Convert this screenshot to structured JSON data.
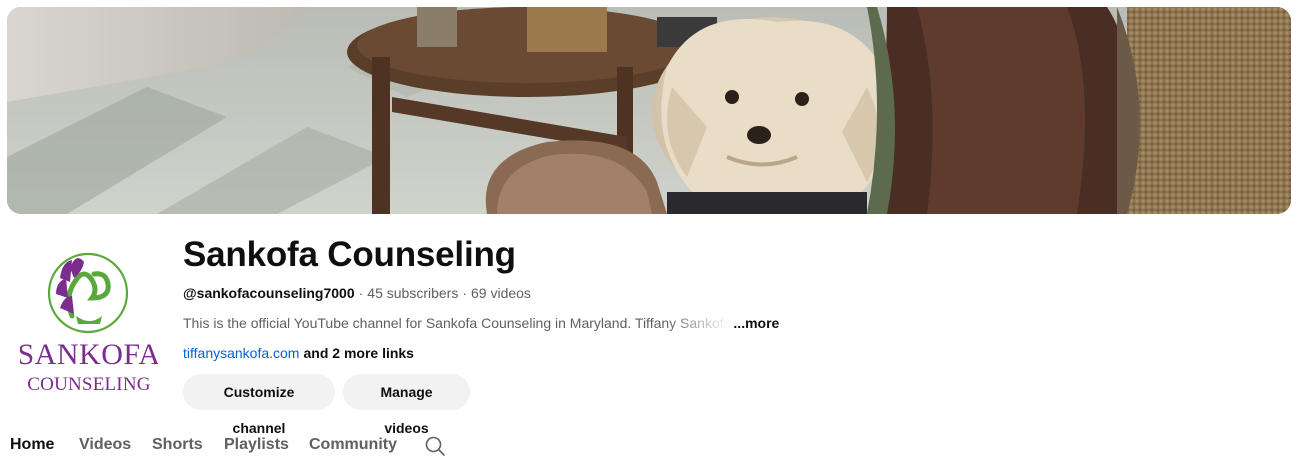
{
  "channel": {
    "name": "Sankofa Counseling",
    "handle": "@sankofacounseling7000",
    "subscribers": "45 subscribers",
    "videos": "69 videos",
    "separator": "·",
    "description": "This is the official YouTube channel for Sankofa Counseling in Maryland. Tiffany Sankofa",
    "more_label": "...more",
    "link_text": "tiffanysankofa.com",
    "more_links_text": "and 2 more links"
  },
  "avatar": {
    "logo_line1": "SANKOFA",
    "logo_line2": "COUNSELING",
    "colors": {
      "purple": "#7b2d8e",
      "green": "#5aa83c"
    }
  },
  "buttons": {
    "customize": "Customize channel",
    "manage": "Manage videos"
  },
  "tabs": [
    {
      "label": "Home",
      "active": true
    },
    {
      "label": "Videos",
      "active": false
    },
    {
      "label": "Shorts",
      "active": false
    },
    {
      "label": "Playlists",
      "active": false
    },
    {
      "label": "Community",
      "active": false
    }
  ],
  "icons": {
    "tab_search": "search-icon"
  },
  "colors": {
    "link": "#065fd4",
    "secondary_text": "#606060",
    "button_bg": "#f2f2f2"
  }
}
